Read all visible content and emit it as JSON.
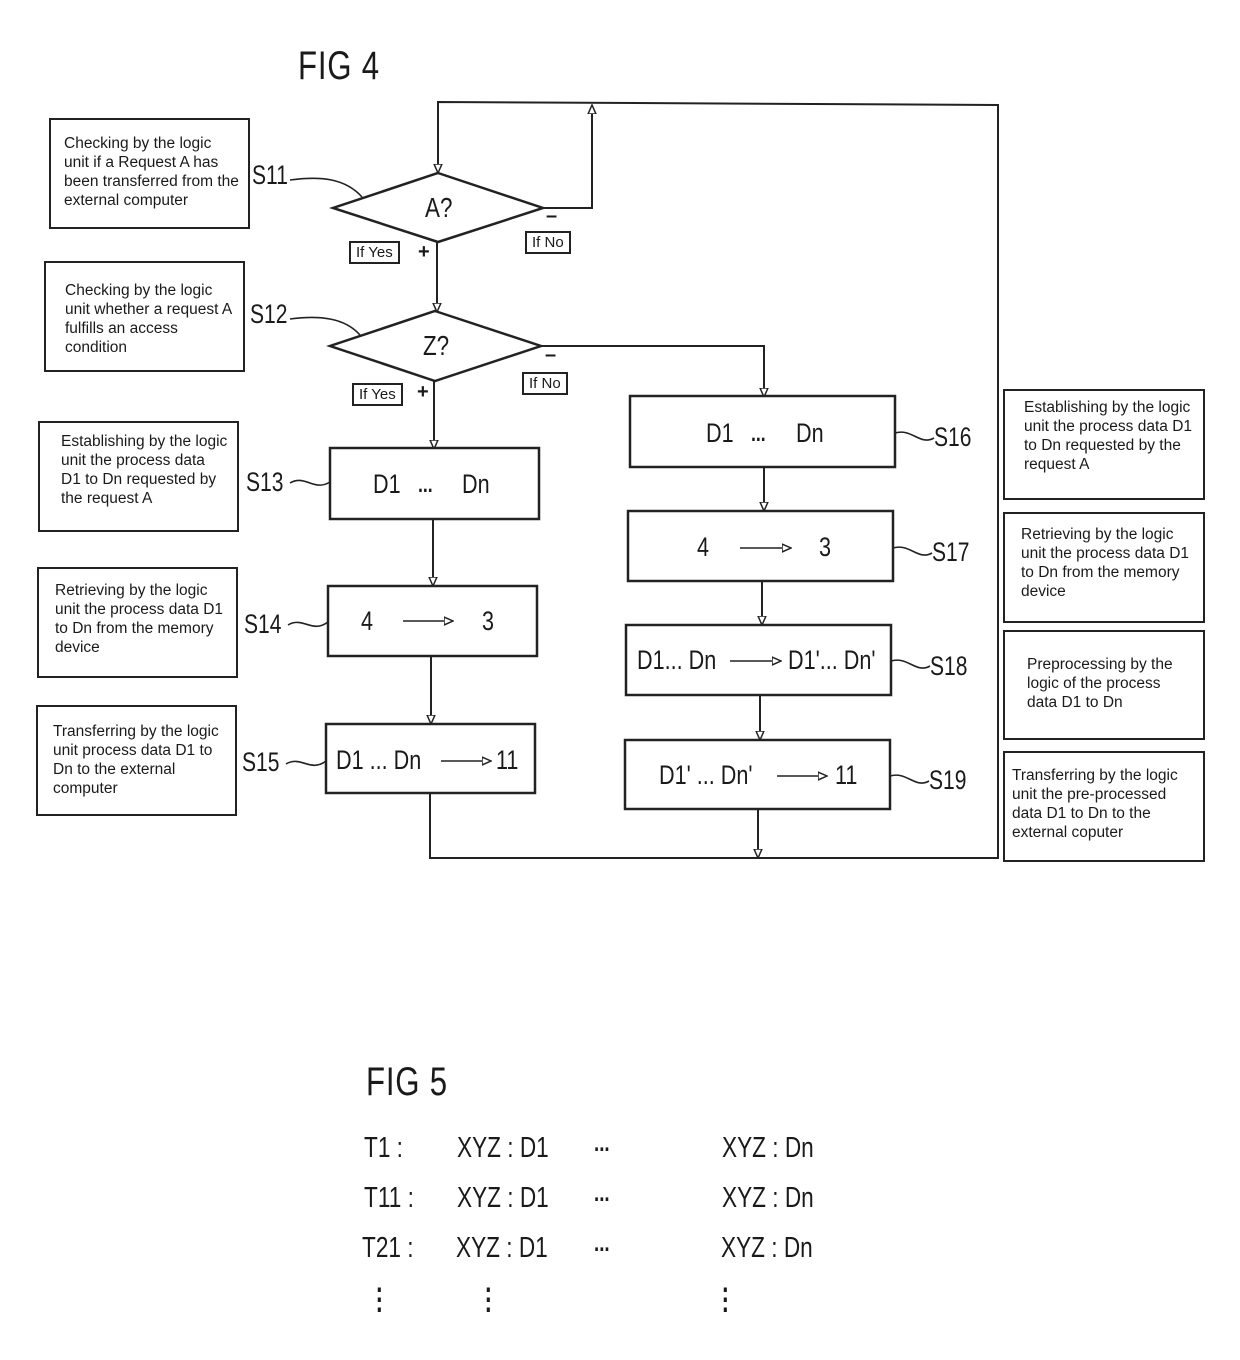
{
  "fig4": {
    "title": "FIG 4",
    "descriptions": {
      "s11": "Checking by the logic unit if a Request A has been transferred from the external computer",
      "s12": "Checking by the logic unit whether a request A fulfills an access condition",
      "s13": "Establishing by the logic unit the process data D1 to Dn requested by the request A",
      "s14": "Retrieving by the logic unit the process data D1 to Dn from the memory device",
      "s15": "Transferring by the logic unit process data D1 to Dn to the external computer",
      "s16": "Establishing by the logic unit the process data D1 to Dn requested by the request A",
      "s17": "Retrieving by the logic unit the process data D1 to Dn from the memory device",
      "s18": "Preprocessing by the logic of the process data D1 to Dn",
      "s19": "Transferring by the logic unit the pre-processed data D1 to Dn to the external coputer"
    },
    "steps": {
      "s11": {
        "label": "S11",
        "content": "A?"
      },
      "s12": {
        "label": "S12",
        "content": "Z?"
      },
      "s13": {
        "label": "S13",
        "left": "D1",
        "dots": "...",
        "right": "Dn"
      },
      "s14": {
        "label": "S14",
        "left": "4",
        "right": "3"
      },
      "s15": {
        "label": "S15",
        "left": "D1 ... Dn",
        "right": "11"
      },
      "s16": {
        "label": "S16",
        "left": "D1",
        "dots": "...",
        "right": "Dn"
      },
      "s17": {
        "label": "S17",
        "left": "4",
        "right": "3"
      },
      "s18": {
        "label": "S18",
        "left": "D1... Dn",
        "right": "D1'... Dn'"
      },
      "s19": {
        "label": "S19",
        "left": "D1' ... Dn'",
        "right": "11"
      }
    },
    "branches": {
      "yes_label": "If Yes",
      "no_label": "If No",
      "yes_sign": "+",
      "no_sign": "–"
    }
  },
  "fig5": {
    "title": "FIG 5",
    "rows": [
      {
        "id": "T1 :",
        "first": "XYZ : D1",
        "dots": "...",
        "last": "XYZ : Dn"
      },
      {
        "id": "T11 :",
        "first": "XYZ : D1",
        "dots": "...",
        "last": "XYZ : Dn"
      },
      {
        "id": "T21 :",
        "first": "XYZ : D1",
        "dots": "...",
        "last": "XYZ : Dn"
      }
    ],
    "continuation": "⋮"
  }
}
